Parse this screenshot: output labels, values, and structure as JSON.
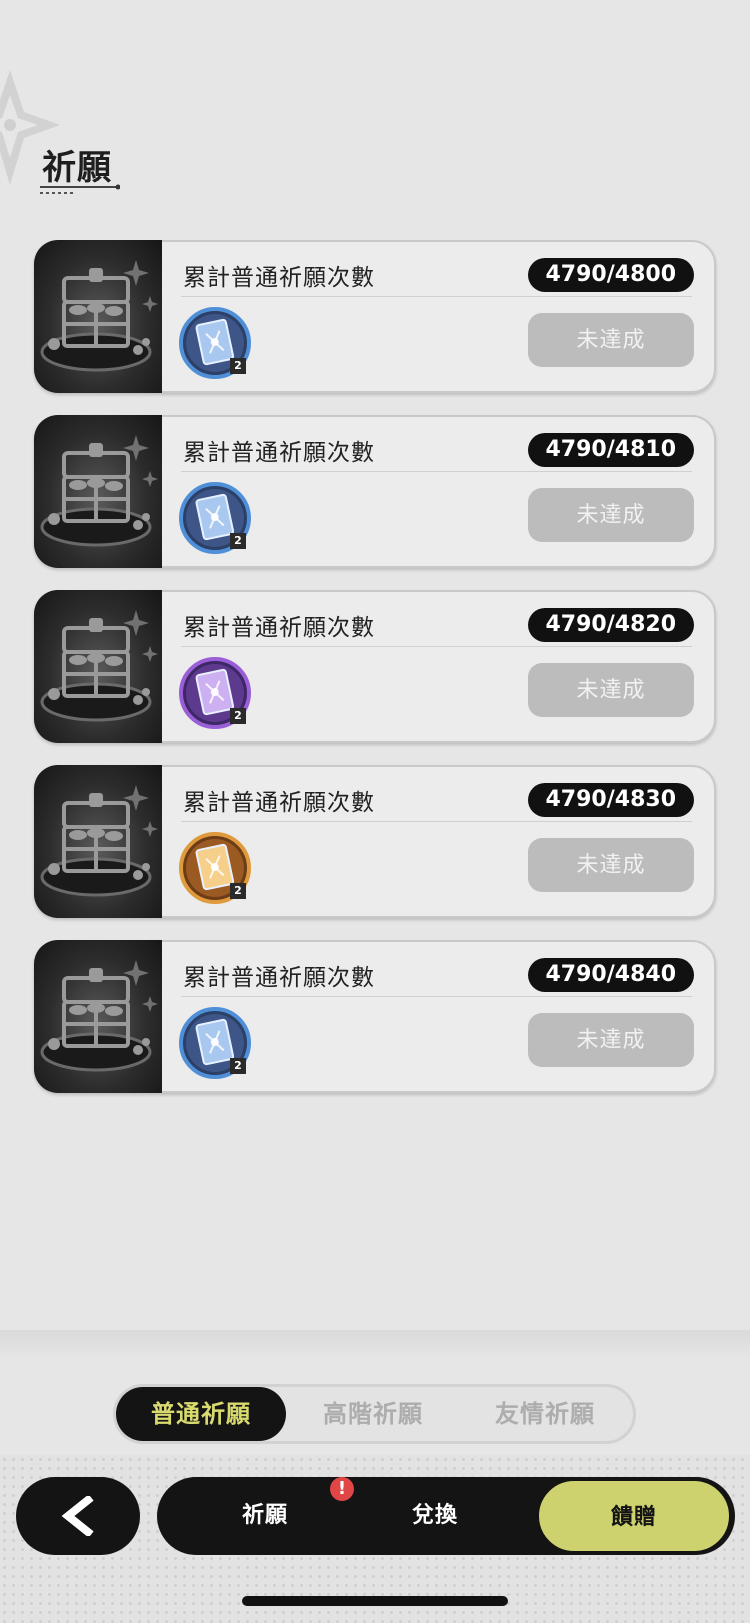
{
  "header": {
    "title": "祈願"
  },
  "missions": [
    {
      "title": "累計普通祈願次數",
      "progress": "4790/4800",
      "reward_count": "2",
      "reward_tier": "blue",
      "status": "未達成"
    },
    {
      "title": "累計普通祈願次數",
      "progress": "4790/4810",
      "reward_count": "2",
      "reward_tier": "blue",
      "status": "未達成"
    },
    {
      "title": "累計普通祈願次數",
      "progress": "4790/4820",
      "reward_count": "2",
      "reward_tier": "purple",
      "status": "未達成"
    },
    {
      "title": "累計普通祈願次數",
      "progress": "4790/4830",
      "reward_count": "2",
      "reward_tier": "gold",
      "status": "未達成"
    },
    {
      "title": "累計普通祈願次數",
      "progress": "4790/4840",
      "reward_count": "2",
      "reward_tier": "blue",
      "status": "未達成"
    }
  ],
  "tabs": [
    {
      "label": "普通祈願",
      "active": true
    },
    {
      "label": "高階祈願",
      "active": false
    },
    {
      "label": "友情祈願",
      "active": false
    }
  ],
  "nav": {
    "items": [
      {
        "label": "祈願",
        "active": false,
        "alert": true
      },
      {
        "label": "兌換",
        "active": false,
        "alert": false
      },
      {
        "label": "饋贈",
        "active": true,
        "alert": false
      }
    ],
    "alert_symbol": "!"
  },
  "colors": {
    "accent": "#cdd26f",
    "accent_text": "#d9db6e",
    "dark": "#141414",
    "status_disabled": "#bcbcbc",
    "alert": "#e04646",
    "tier_blue": "#4f8fd8",
    "tier_purple": "#9a5fd6",
    "tier_gold": "#e09a3e"
  },
  "icons": {
    "back": "chevron-left-icon",
    "chest": "treasure-chest-icon",
    "reward": "wish-card-icon",
    "alert": "exclamation-icon"
  }
}
